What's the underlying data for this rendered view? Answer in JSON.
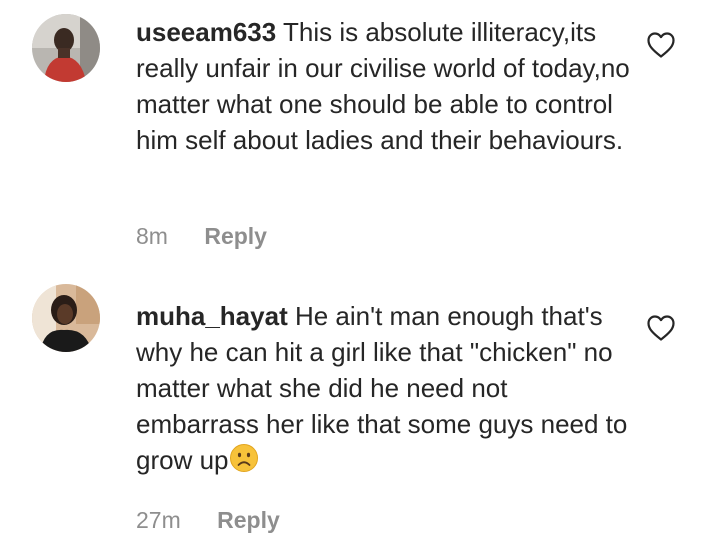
{
  "comments": [
    {
      "username": "useeam633",
      "text": "This is absolute illiteracy,its really unfair in our civilise world of today,no matter what one should be able to control him self about ladies and their behaviours.",
      "time": "8m",
      "reply_label": "Reply",
      "avatar_icon": "user-avatar-photo"
    },
    {
      "username": "muha_hayat",
      "text": "He ain't man enough that's why he can hit a girl like that \"chicken\" no matter what she did he need not embarrass her like that some guys need to grow up",
      "emoji": "sad-face-emoji",
      "time": "27m",
      "reply_label": "Reply",
      "avatar_icon": "user-avatar-photo"
    }
  ],
  "like_icon": "heart-outline-icon",
  "colors": {
    "text": "#262626",
    "meta": "#8e8e8e",
    "emoji": "#f7c23a"
  }
}
